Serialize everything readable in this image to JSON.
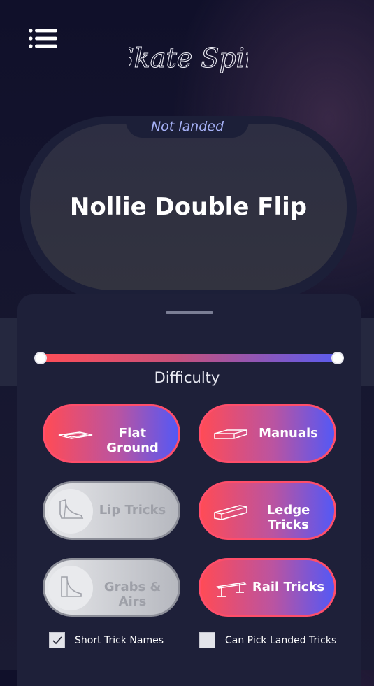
{
  "header": {
    "logo_text": "Skate Spin",
    "menu_icon": "list-icon"
  },
  "trick_card": {
    "status": "Not landed",
    "trick_name": "Nollie Double Flip"
  },
  "difficulty": {
    "label": "Difficulty",
    "range": [
      0,
      1
    ]
  },
  "categories": [
    {
      "label": "Flat Ground",
      "icon": "flat-ground-icon",
      "enabled": true
    },
    {
      "label": "Manuals",
      "icon": "manual-pad-icon",
      "enabled": true
    },
    {
      "label": "Lip Tricks",
      "icon": "quarter-pipe-icon",
      "enabled": false
    },
    {
      "label": "Ledge Tricks",
      "icon": "ledge-icon",
      "enabled": true
    },
    {
      "label": "Grabs & Airs",
      "icon": "ramp-icon",
      "enabled": false
    },
    {
      "label": "Rail Tricks",
      "icon": "rail-icon",
      "enabled": true
    }
  ],
  "options": {
    "short_names": {
      "label": "Short Trick Names",
      "checked": true
    },
    "pick_landed": {
      "label": "Can Pick Landed Tricks",
      "checked": false
    }
  },
  "colors": {
    "accent_red": "#ff4e57",
    "accent_blue": "#5458f5",
    "status_text": "#a5b0f5"
  }
}
